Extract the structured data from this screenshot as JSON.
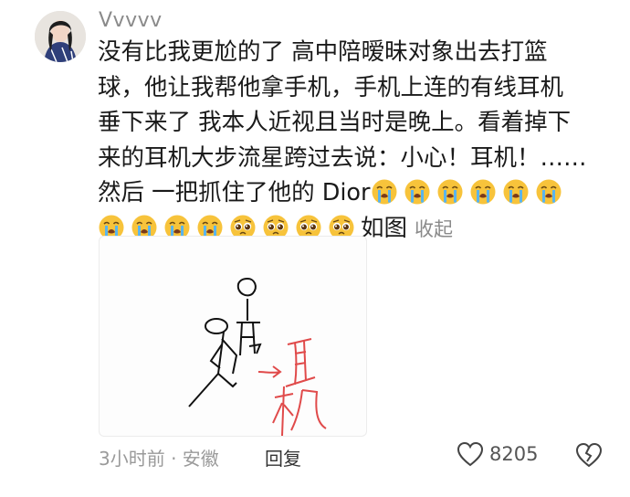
{
  "comment": {
    "username": "Vvvvv",
    "lines": [
      "没有比我更尬的了 高中陪暧昧对象出去打篮",
      "球，他让我帮他拿手机，手机上连的有线耳机",
      "垂下来了 我本人近视且当时是晚上。看着掉下",
      "来的耳机大步流星跨过去说：小心！耳机！……"
    ],
    "line5_text": "然后 一把抓住了他的 Dior",
    "line6_text": "如图",
    "collapse_label": "收起",
    "emoji_crying": "loudly-crying-face-emoji",
    "emoji_pleading": "pleading-face-emoji",
    "image": {
      "annotation": "耳机"
    }
  },
  "footer": {
    "meta": "3小时前 · 安徽",
    "reply_label": "回复",
    "like_count": "8205"
  },
  "colors": {
    "meta_gray": "#9a9a9a",
    "annotation_red": "#e04a4a"
  }
}
